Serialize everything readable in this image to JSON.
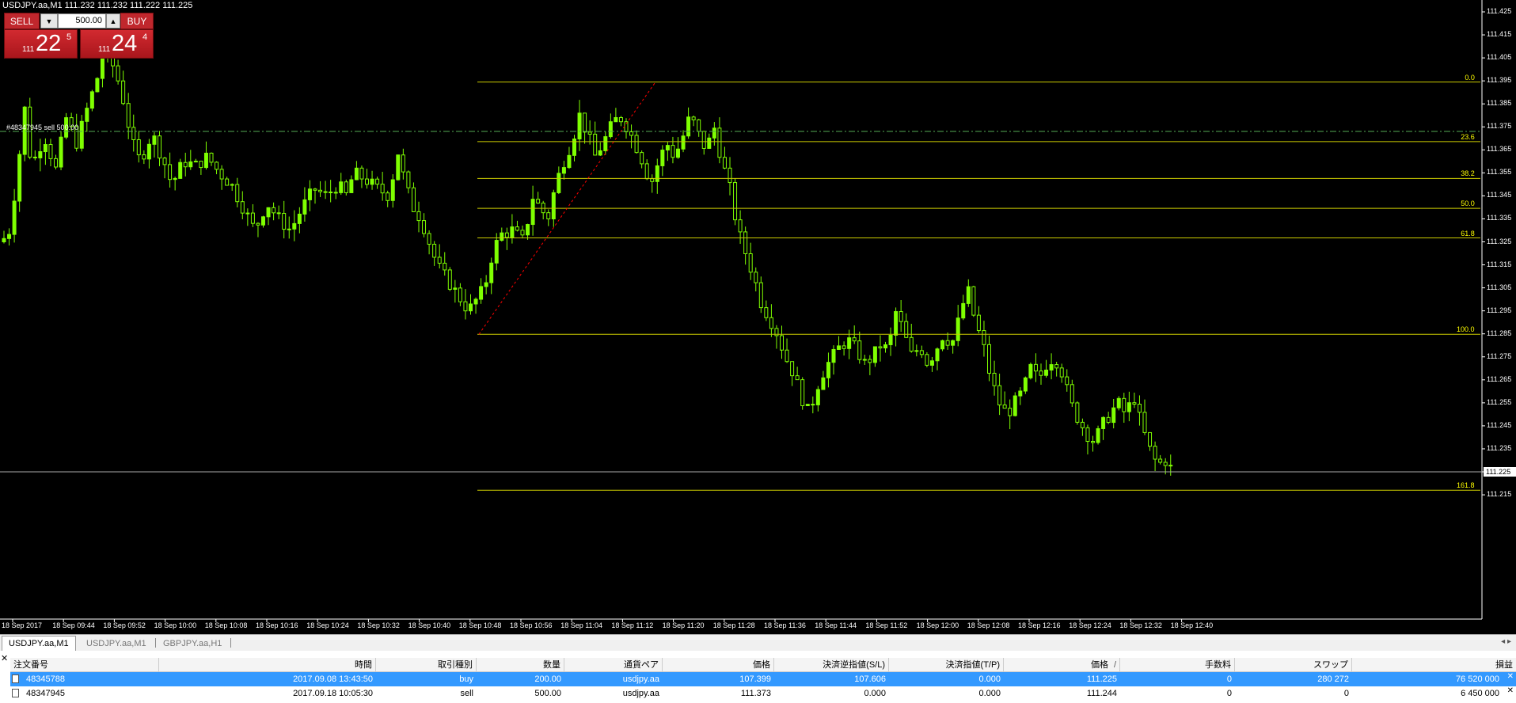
{
  "window": {
    "symbol_line": "USDJPY.aa,M1  111.232 111.232 111.222 111.225"
  },
  "trade_panel": {
    "sell_label": "SELL",
    "buy_label": "BUY",
    "lot_value": "500.00",
    "sell_price": {
      "prefix": "111",
      "big": "22",
      "sup": "5"
    },
    "buy_price": {
      "prefix": "111",
      "big": "24",
      "sup": "4"
    }
  },
  "chart": {
    "order_line_label": "#48347945 sell 500.00",
    "price_axis": [
      "111.425",
      "111.415",
      "111.405",
      "111.395",
      "111.385",
      "111.375",
      "111.365",
      "111.355",
      "111.345",
      "111.335",
      "111.325",
      "111.315",
      "111.305",
      "111.295",
      "111.285",
      "111.275",
      "111.265",
      "111.255",
      "111.245",
      "111.235",
      "111.225",
      "111.215"
    ],
    "current_price": "111.225",
    "time_axis": [
      "18 Sep 2017",
      "18 Sep 09:44",
      "18 Sep 09:52",
      "18 Sep 10:00",
      "18 Sep 10:08",
      "18 Sep 10:16",
      "18 Sep 10:24",
      "18 Sep 10:32",
      "18 Sep 10:40",
      "18 Sep 10:48",
      "18 Sep 10:56",
      "18 Sep 11:04",
      "18 Sep 11:12",
      "18 Sep 11:20",
      "18 Sep 11:28",
      "18 Sep 11:36",
      "18 Sep 11:44",
      "18 Sep 11:52",
      "18 Sep 12:00",
      "18 Sep 12:08",
      "18 Sep 12:16",
      "18 Sep 12:24",
      "18 Sep 12:32",
      "18 Sep 12:40"
    ],
    "fib_levels": [
      {
        "label": "0.0",
        "price": 111.3945
      },
      {
        "label": "23.6",
        "price": 111.3686
      },
      {
        "label": "38.2",
        "price": 111.3526
      },
      {
        "label": "50.0",
        "price": 111.3396
      },
      {
        "label": "61.8",
        "price": 111.3267
      },
      {
        "label": "100.0",
        "price": 111.2848
      },
      {
        "label": "161.8",
        "price": 111.217
      }
    ],
    "order_price": 111.373,
    "colors": {
      "candle_bull": "#7fff00",
      "candle_bear": "#000000",
      "fib": "#cccc00",
      "trend": "#ff0000",
      "order_line": "#55aa55"
    }
  },
  "tabs": [
    {
      "label": "USDJPY.aa,M1",
      "active": true
    },
    {
      "label": "USDJPY.aa,M1",
      "active": false
    },
    {
      "label": "GBPJPY.aa,H1",
      "active": false
    }
  ],
  "tab_arrows": "◂ ▸",
  "terminal": {
    "columns": [
      "注文番号",
      "時間",
      "取引種別",
      "数量",
      "通貨ペア",
      "価格",
      "決済逆指値(S/L)",
      "決済指値(T/P)",
      "価格",
      "手数料",
      "スワップ",
      "損益"
    ],
    "sort_mark": "/",
    "rows": [
      {
        "order": "48345788",
        "time": "2017.09.08 13:43:50",
        "type": "buy",
        "volume": "200.00",
        "pair": "usdjpy.aa",
        "open_price": "107.399",
        "sl": "107.606",
        "tp": "0.000",
        "price": "111.225",
        "commission": "0",
        "swap": "280 272",
        "profit": "76 520 000"
      },
      {
        "order": "48347945",
        "time": "2017.09.18 10:05:30",
        "type": "sell",
        "volume": "500.00",
        "pair": "usdjpy.aa",
        "open_price": "111.373",
        "sl": "0.000",
        "tp": "0.000",
        "price": "111.244",
        "commission": "0",
        "swap": "0",
        "profit": "6 450 000"
      }
    ]
  }
}
